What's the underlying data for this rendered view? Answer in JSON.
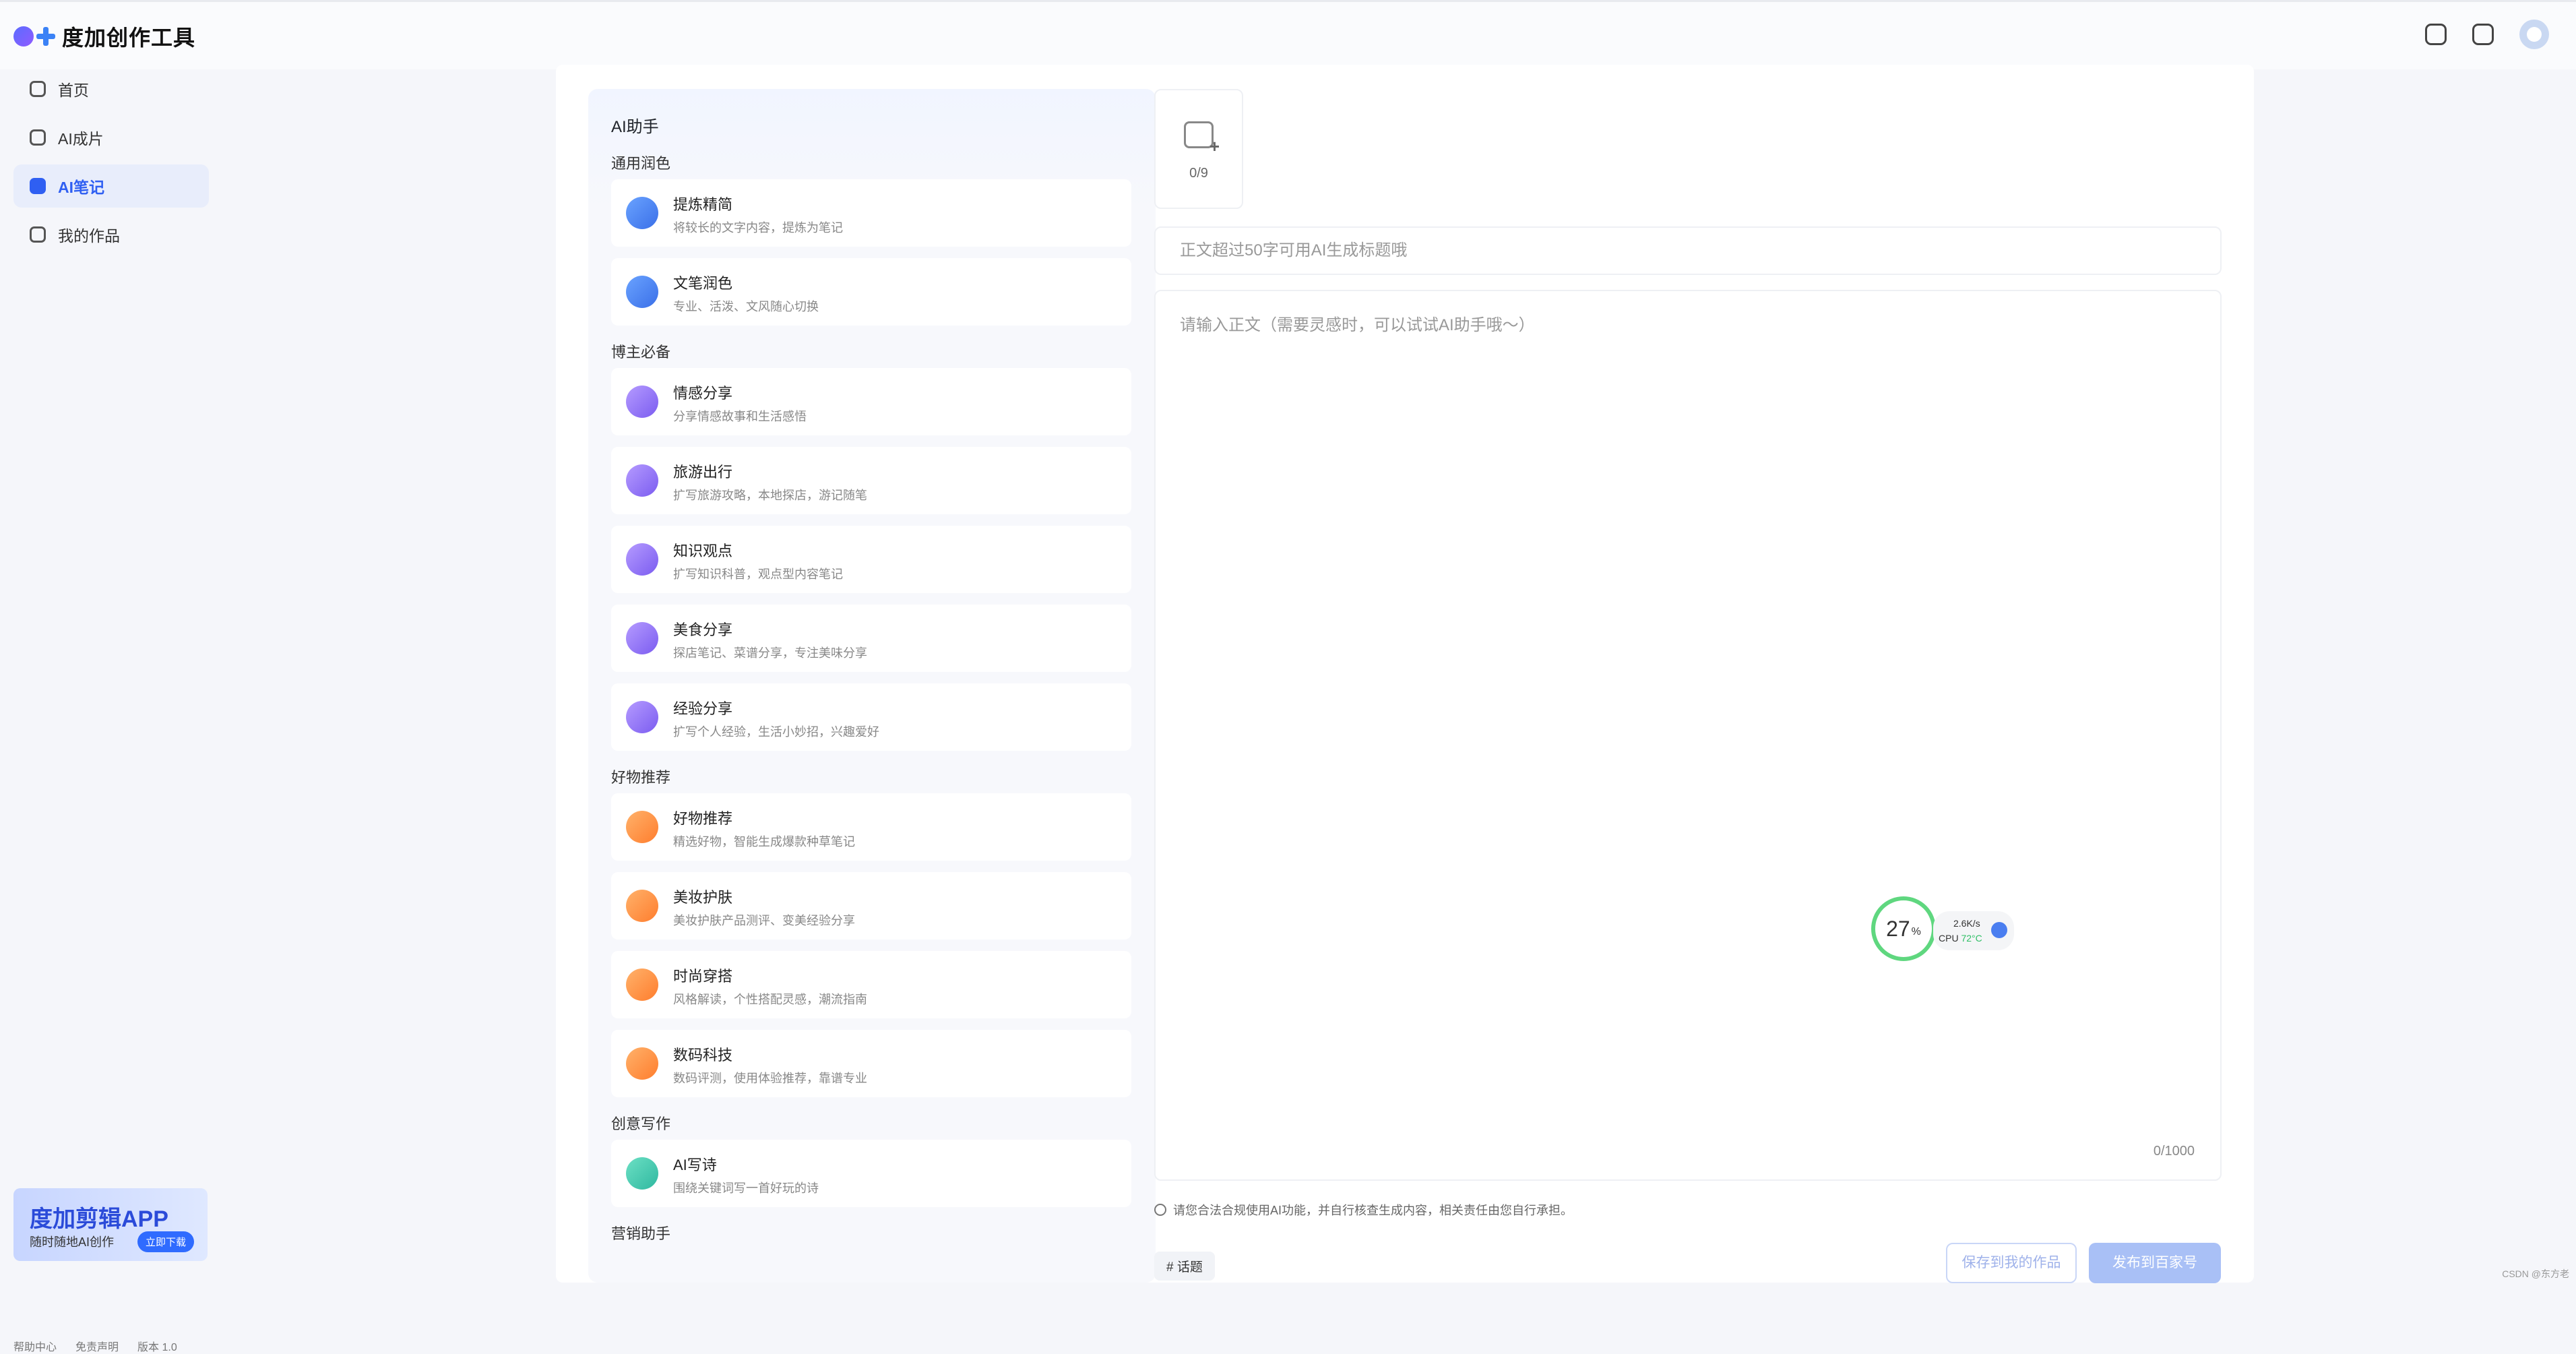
{
  "app": {
    "name": "度加创作工具"
  },
  "sidebar": {
    "items": [
      {
        "label": "首页",
        "active": false
      },
      {
        "label": "AI成片",
        "active": false
      },
      {
        "label": "AI笔记",
        "active": true
      },
      {
        "label": "我的作品",
        "active": false
      }
    ],
    "banner": {
      "title": "度加剪辑APP",
      "subtitle": "随时随地AI创作",
      "button": "立即下载"
    }
  },
  "ai_panel": {
    "title": "AI助手",
    "sections": [
      {
        "title": "通用润色",
        "tools": [
          {
            "name": "提炼精简",
            "desc": "将较长的文字内容，提炼为笔记",
            "icon": "wand-icon",
            "color": "blue"
          },
          {
            "name": "文笔润色",
            "desc": "专业、活泼、文风随心切换",
            "icon": "cup-icon",
            "color": "blue"
          }
        ]
      },
      {
        "title": "博主必备",
        "tools": [
          {
            "name": "情感分享",
            "desc": "分享情感故事和生活感悟",
            "icon": "heart-icon",
            "color": "purple"
          },
          {
            "name": "旅游出行",
            "desc": "扩写旅游攻略，本地探店，游记随笔",
            "icon": "palm-icon",
            "color": "purple"
          },
          {
            "name": "知识观点",
            "desc": "扩写知识科普，观点型内容笔记",
            "icon": "book-icon",
            "color": "purple"
          },
          {
            "name": "美食分享",
            "desc": "探店笔记、菜谱分享，专注美味分享",
            "icon": "food-icon",
            "color": "purple"
          },
          {
            "name": "经验分享",
            "desc": "扩写个人经验，生活小妙招，兴趣爱好",
            "icon": "bulb-icon",
            "color": "purple"
          }
        ]
      },
      {
        "title": "好物推荐",
        "tools": [
          {
            "name": "好物推荐",
            "desc": "精选好物，智能生成爆款种草笔记",
            "icon": "thumb-icon",
            "color": "orange"
          },
          {
            "name": "美妆护肤",
            "desc": "美妆护肤产品测评、变美经验分享",
            "icon": "bottle-icon",
            "color": "orange"
          },
          {
            "name": "时尚穿搭",
            "desc": "风格解读，个性搭配灵感，潮流指南",
            "icon": "shirt-icon",
            "color": "orange"
          },
          {
            "name": "数码科技",
            "desc": "数码评测，使用体验推荐，靠谱专业",
            "icon": "camera-icon",
            "color": "orange"
          }
        ]
      },
      {
        "title": "创意写作",
        "tools": [
          {
            "name": "AI写诗",
            "desc": "围绕关键词写一首好玩的诗",
            "icon": "poem-icon",
            "color": "teal"
          }
        ]
      },
      {
        "title": "营销助手",
        "tools": []
      }
    ]
  },
  "editor": {
    "image_count": "0/9",
    "title_placeholder": "正文超过50字可用AI生成标题哦",
    "body_placeholder": "请输入正文（需要灵感时，可以试试AI助手哦～）",
    "char_count": "0/1000",
    "notice": "请您合法合规使用AI功能，并自行核查生成内容，相关责任由您自行承担。",
    "topic_label": "# 话题",
    "save_label": "保存到我的作品",
    "publish_label": "发布到百家号"
  },
  "cpu_widget": {
    "percent": "27",
    "percent_unit": "%",
    "speed": "2.6K/s",
    "label": "CPU",
    "temp": "72°C"
  },
  "footer": {
    "links": [
      "帮助中心",
      "免责声明",
      "版本 1.0"
    ]
  },
  "watermark": "CSDN @东方老",
  "colors": {
    "accent": "#2f5ff2",
    "publish": "#a9c0f6",
    "background": "#f5f6fa"
  }
}
